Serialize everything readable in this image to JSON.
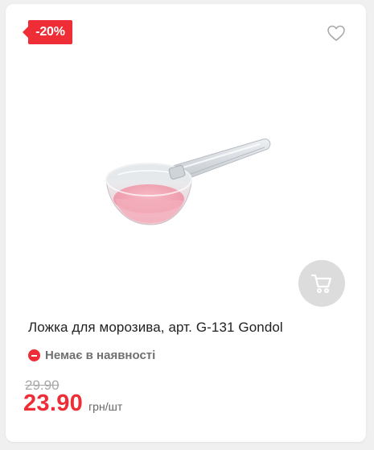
{
  "product": {
    "discount_badge": "-20%",
    "title": "Ложка для морозива, арт. G-131 Gondol",
    "stock_status": "Немає в наявності",
    "old_price": "29.90",
    "price": "23.90",
    "unit": "грн/шт"
  },
  "icons": {
    "favorite": "heart-outline-icon",
    "cart": "cart-icon",
    "stock": "minus-circle-icon"
  },
  "colors": {
    "accent": "#ee2d36",
    "cart_button_bg": "#dcdcdc",
    "old_price": "#a8a8a8",
    "stock_text": "#707070"
  }
}
